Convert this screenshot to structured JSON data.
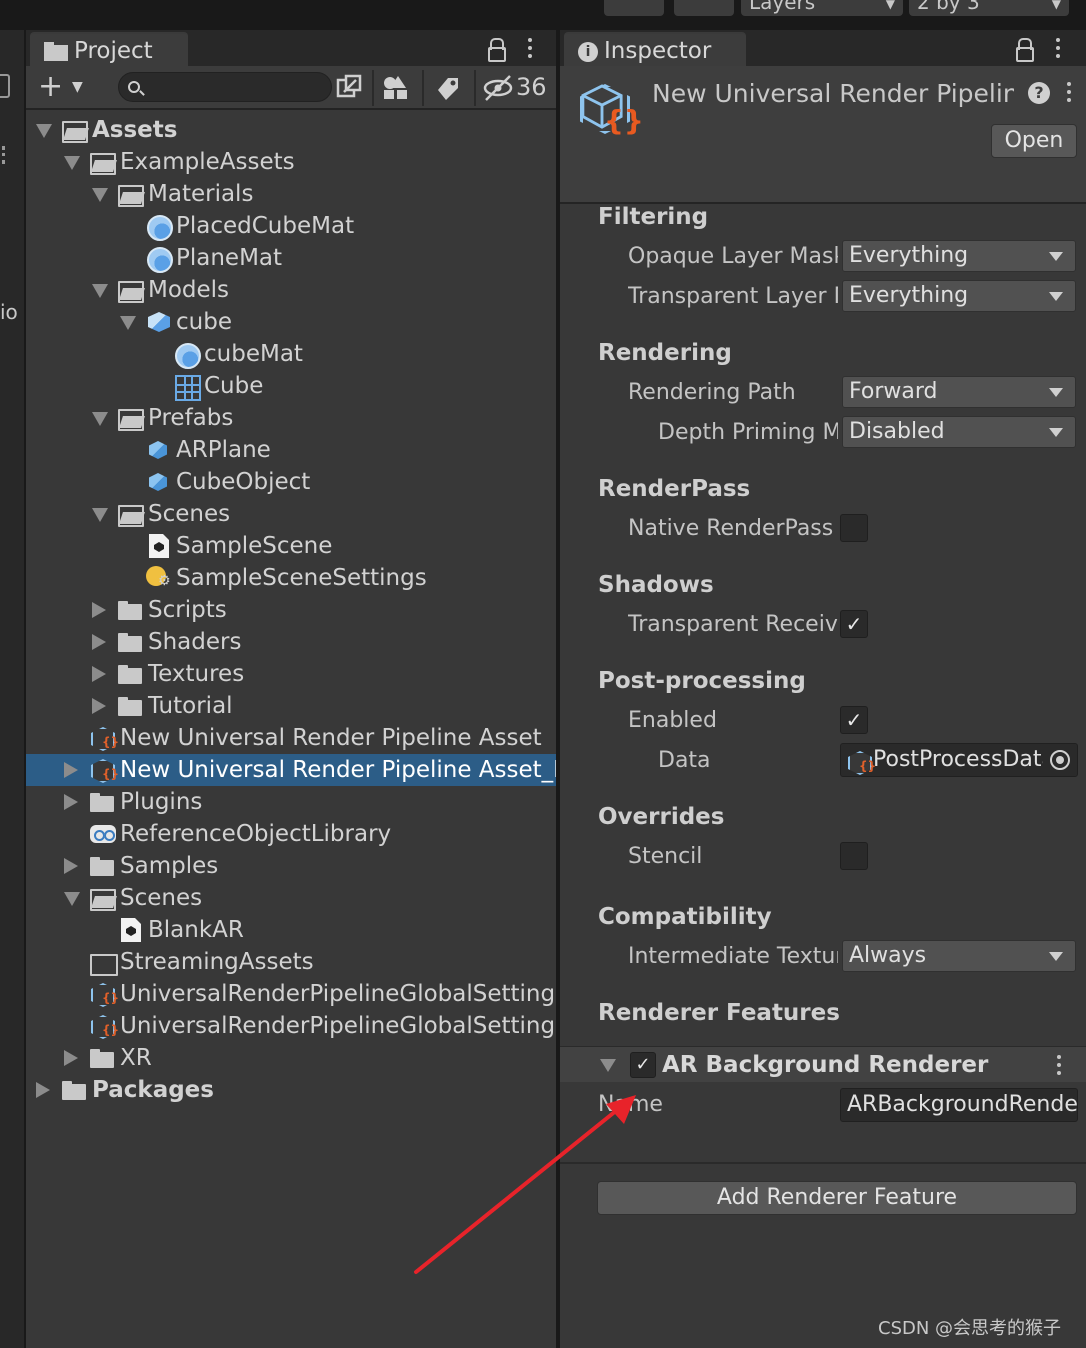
{
  "topbar": {
    "layers_label": "Layers",
    "layout_label": "2 by 3"
  },
  "left_sliver": {
    "text": "io"
  },
  "project": {
    "tab_label": "Project",
    "hidden_count": "36",
    "search_placeholder": "",
    "tree": [
      {
        "label": "Assets",
        "depth": 0,
        "expand": "down",
        "icon": "folder-open",
        "bold": true
      },
      {
        "label": "ExampleAssets",
        "depth": 1,
        "expand": "down",
        "icon": "folder-open"
      },
      {
        "label": "Materials",
        "depth": 2,
        "expand": "down",
        "icon": "folder-open"
      },
      {
        "label": "PlacedCubeMat",
        "depth": 3,
        "expand": "none",
        "icon": "material"
      },
      {
        "label": "PlaneMat",
        "depth": 3,
        "expand": "none",
        "icon": "material"
      },
      {
        "label": "Models",
        "depth": 2,
        "expand": "down",
        "icon": "folder-open"
      },
      {
        "label": "cube",
        "depth": 3,
        "expand": "down",
        "icon": "model"
      },
      {
        "label": "cubeMat",
        "depth": 4,
        "expand": "none",
        "icon": "material"
      },
      {
        "label": "Cube",
        "depth": 4,
        "expand": "none",
        "icon": "mesh"
      },
      {
        "label": "Prefabs",
        "depth": 2,
        "expand": "down",
        "icon": "folder-open"
      },
      {
        "label": "ARPlane",
        "depth": 3,
        "expand": "none",
        "icon": "prefab"
      },
      {
        "label": "CubeObject",
        "depth": 3,
        "expand": "none",
        "icon": "prefab"
      },
      {
        "label": "Scenes",
        "depth": 2,
        "expand": "down",
        "icon": "folder-open"
      },
      {
        "label": "SampleScene",
        "depth": 3,
        "expand": "none",
        "icon": "scene"
      },
      {
        "label": "SampleSceneSettings",
        "depth": 3,
        "expand": "none",
        "icon": "settings"
      },
      {
        "label": "Scripts",
        "depth": 2,
        "expand": "right",
        "icon": "folder-closed"
      },
      {
        "label": "Shaders",
        "depth": 2,
        "expand": "right",
        "icon": "folder-closed"
      },
      {
        "label": "Textures",
        "depth": 2,
        "expand": "right",
        "icon": "folder-closed"
      },
      {
        "label": "Tutorial",
        "depth": 2,
        "expand": "right",
        "icon": "folder-closed"
      },
      {
        "label": "New Universal Render Pipeline Asset",
        "depth": 1,
        "expand": "none",
        "icon": "urp"
      },
      {
        "label": "New Universal Render Pipeline Asset_Renderer",
        "depth": 1,
        "expand": "right",
        "icon": "urp",
        "selected": true
      },
      {
        "label": "Plugins",
        "depth": 1,
        "expand": "right",
        "icon": "folder-closed"
      },
      {
        "label": "ReferenceObjectLibrary",
        "depth": 1,
        "expand": "none",
        "icon": "reference"
      },
      {
        "label": "Samples",
        "depth": 1,
        "expand": "right",
        "icon": "folder-closed"
      },
      {
        "label": "Scenes",
        "depth": 1,
        "expand": "down",
        "icon": "folder-open"
      },
      {
        "label": "BlankAR",
        "depth": 2,
        "expand": "none",
        "icon": "scene"
      },
      {
        "label": "StreamingAssets",
        "depth": 1,
        "expand": "none",
        "icon": "folder-empty"
      },
      {
        "label": "UniversalRenderPipelineGlobalSettings",
        "depth": 1,
        "expand": "none",
        "icon": "urp"
      },
      {
        "label": "UniversalRenderPipelineGlobalSettings",
        "depth": 1,
        "expand": "none",
        "icon": "urp"
      },
      {
        "label": "XR",
        "depth": 1,
        "expand": "right",
        "icon": "folder-closed"
      },
      {
        "label": "Packages",
        "depth": 0,
        "expand": "right",
        "icon": "folder-closed",
        "bold": true
      }
    ]
  },
  "inspector": {
    "tab_label": "Inspector",
    "title": "New Universal Render Pipeline Asset_Renderer",
    "open_label": "Open",
    "help_glyph": "?",
    "sections": {
      "filtering": "Filtering",
      "rendering": "Rendering",
      "renderpass": "RenderPass",
      "shadows": "Shadows",
      "postprocessing": "Post-processing",
      "overrides": "Overrides",
      "compatibility": "Compatibility",
      "renderer_features": "Renderer Features"
    },
    "props": {
      "opaque_layer_mask": {
        "label": "Opaque Layer Mask",
        "value": "Everything"
      },
      "transparent_layer_mask": {
        "label": "Transparent Layer Mask",
        "value": "Everything"
      },
      "rendering_path": {
        "label": "Rendering Path",
        "value": "Forward"
      },
      "depth_priming_mode": {
        "label": "Depth Priming Mode",
        "value": "Disabled"
      },
      "native_renderpass": {
        "label": "Native RenderPass",
        "checked": false
      },
      "transparent_receive_shadows": {
        "label": "Transparent Receive Shadows",
        "checked": true
      },
      "pp_enabled": {
        "label": "Enabled",
        "checked": true
      },
      "pp_data": {
        "label": "Data",
        "value": "PostProcessData"
      },
      "stencil": {
        "label": "Stencil",
        "checked": false
      },
      "intermediate_texture": {
        "label": "Intermediate Texture",
        "value": "Always"
      }
    },
    "feature": {
      "title": "AR Background Renderer Feature",
      "enabled": true,
      "name_label": "Name",
      "name_value": "ARBackgroundRendererFeature"
    },
    "add_feature_label": "Add Renderer Feature",
    "check_glyph": "✓"
  },
  "annotation": {
    "color": "#e8232a"
  },
  "watermark": "CSDN @会思考的猴子"
}
